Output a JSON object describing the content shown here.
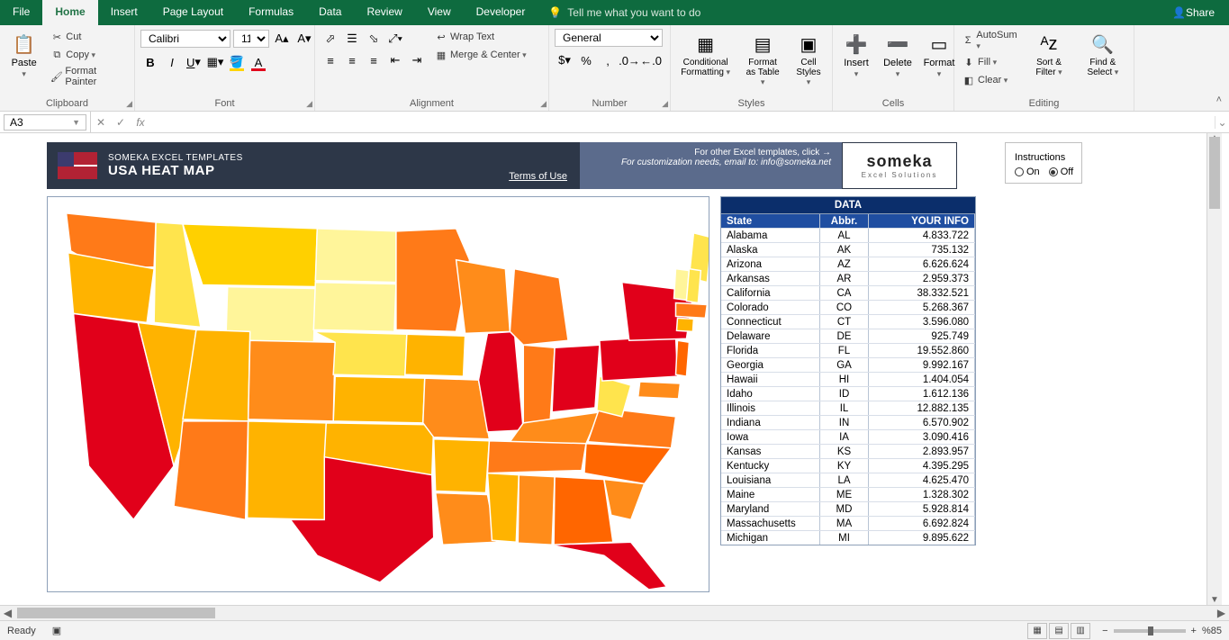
{
  "menu": {
    "tabs": [
      "File",
      "Home",
      "Insert",
      "Page Layout",
      "Formulas",
      "Data",
      "Review",
      "View",
      "Developer"
    ],
    "active": "Home",
    "tell_me": "Tell me what you want to do",
    "share": "Share"
  },
  "ribbon": {
    "clipboard": {
      "label": "Clipboard",
      "paste": "Paste",
      "cut": "Cut",
      "copy": "Copy",
      "format_painter": "Format Painter"
    },
    "font": {
      "label": "Font",
      "name": "Calibri",
      "size": "11"
    },
    "alignment": {
      "label": "Alignment",
      "wrap": "Wrap Text",
      "merge": "Merge & Center"
    },
    "number": {
      "label": "Number",
      "format": "General"
    },
    "styles": {
      "label": "Styles",
      "conditional": "Conditional Formatting",
      "format_as": "Format as Table",
      "cell": "Cell Styles"
    },
    "cells": {
      "label": "Cells",
      "insert": "Insert",
      "delete": "Delete",
      "format": "Format"
    },
    "editing": {
      "label": "Editing",
      "autosum": "AutoSum",
      "fill": "Fill",
      "clear": "Clear",
      "sort": "Sort & Filter",
      "find": "Find & Select"
    }
  },
  "formula": {
    "cell": "A3",
    "value": ""
  },
  "template": {
    "subtitle": "SOMEKA EXCEL TEMPLATES",
    "title": "USA HEAT MAP",
    "terms": "Terms of Use",
    "line1": "For other Excel templates, click →",
    "line2": "For customization needs, email to: info@someka.net",
    "brand": "someka",
    "brand_tag": "Excel Solutions"
  },
  "instructions": {
    "label": "Instructions",
    "on": "On",
    "off": "Off",
    "selected": "off"
  },
  "data_table": {
    "title": "DATA",
    "headers": {
      "state": "State",
      "abbr": "Abbr.",
      "info": "YOUR INFO"
    },
    "rows": [
      {
        "state": "Alabama",
        "abbr": "AL",
        "info": "4.833.722"
      },
      {
        "state": "Alaska",
        "abbr": "AK",
        "info": "735.132"
      },
      {
        "state": "Arizona",
        "abbr": "AZ",
        "info": "6.626.624"
      },
      {
        "state": "Arkansas",
        "abbr": "AR",
        "info": "2.959.373"
      },
      {
        "state": "California",
        "abbr": "CA",
        "info": "38.332.521"
      },
      {
        "state": "Colorado",
        "abbr": "CO",
        "info": "5.268.367"
      },
      {
        "state": "Connecticut",
        "abbr": "CT",
        "info": "3.596.080"
      },
      {
        "state": "Delaware",
        "abbr": "DE",
        "info": "925.749"
      },
      {
        "state": "Florida",
        "abbr": "FL",
        "info": "19.552.860"
      },
      {
        "state": "Georgia",
        "abbr": "GA",
        "info": "9.992.167"
      },
      {
        "state": "Hawaii",
        "abbr": "HI",
        "info": "1.404.054"
      },
      {
        "state": "Idaho",
        "abbr": "ID",
        "info": "1.612.136"
      },
      {
        "state": "Illinois",
        "abbr": "IL",
        "info": "12.882.135"
      },
      {
        "state": "Indiana",
        "abbr": "IN",
        "info": "6.570.902"
      },
      {
        "state": "Iowa",
        "abbr": "IA",
        "info": "3.090.416"
      },
      {
        "state": "Kansas",
        "abbr": "KS",
        "info": "2.893.957"
      },
      {
        "state": "Kentucky",
        "abbr": "KY",
        "info": "4.395.295"
      },
      {
        "state": "Louisiana",
        "abbr": "LA",
        "info": "4.625.470"
      },
      {
        "state": "Maine",
        "abbr": "ME",
        "info": "1.328.302"
      },
      {
        "state": "Maryland",
        "abbr": "MD",
        "info": "5.928.814"
      },
      {
        "state": "Massachusetts",
        "abbr": "MA",
        "info": "6.692.824"
      },
      {
        "state": "Michigan",
        "abbr": "MI",
        "info": "9.895.622"
      }
    ]
  },
  "chart_data": {
    "type": "heatmap",
    "title": "USA HEAT MAP",
    "geography": "usa_states",
    "color_field": "population",
    "color_scale": "yellow_to_red",
    "series": [
      {
        "state": "Alabama",
        "abbr": "AL",
        "value": 4833722
      },
      {
        "state": "Alaska",
        "abbr": "AK",
        "value": 735132
      },
      {
        "state": "Arizona",
        "abbr": "AZ",
        "value": 6626624
      },
      {
        "state": "Arkansas",
        "abbr": "AR",
        "value": 2959373
      },
      {
        "state": "California",
        "abbr": "CA",
        "value": 38332521
      },
      {
        "state": "Colorado",
        "abbr": "CO",
        "value": 5268367
      },
      {
        "state": "Connecticut",
        "abbr": "CT",
        "value": 3596080
      },
      {
        "state": "Delaware",
        "abbr": "DE",
        "value": 925749
      },
      {
        "state": "Florida",
        "abbr": "FL",
        "value": 19552860
      },
      {
        "state": "Georgia",
        "abbr": "GA",
        "value": 9992167
      },
      {
        "state": "Hawaii",
        "abbr": "HI",
        "value": 1404054
      },
      {
        "state": "Idaho",
        "abbr": "ID",
        "value": 1612136
      },
      {
        "state": "Illinois",
        "abbr": "IL",
        "value": 12882135
      },
      {
        "state": "Indiana",
        "abbr": "IN",
        "value": 6570902
      },
      {
        "state": "Iowa",
        "abbr": "IA",
        "value": 3090416
      },
      {
        "state": "Kansas",
        "abbr": "KS",
        "value": 2893957
      },
      {
        "state": "Kentucky",
        "abbr": "KY",
        "value": 4395295
      },
      {
        "state": "Louisiana",
        "abbr": "LA",
        "value": 4625470
      },
      {
        "state": "Maine",
        "abbr": "ME",
        "value": 1328302
      },
      {
        "state": "Maryland",
        "abbr": "MD",
        "value": 5928814
      },
      {
        "state": "Massachusetts",
        "abbr": "MA",
        "value": 6692824
      },
      {
        "state": "Michigan",
        "abbr": "MI",
        "value": 9895622
      }
    ]
  },
  "status": {
    "ready": "Ready",
    "zoom": "%85"
  }
}
